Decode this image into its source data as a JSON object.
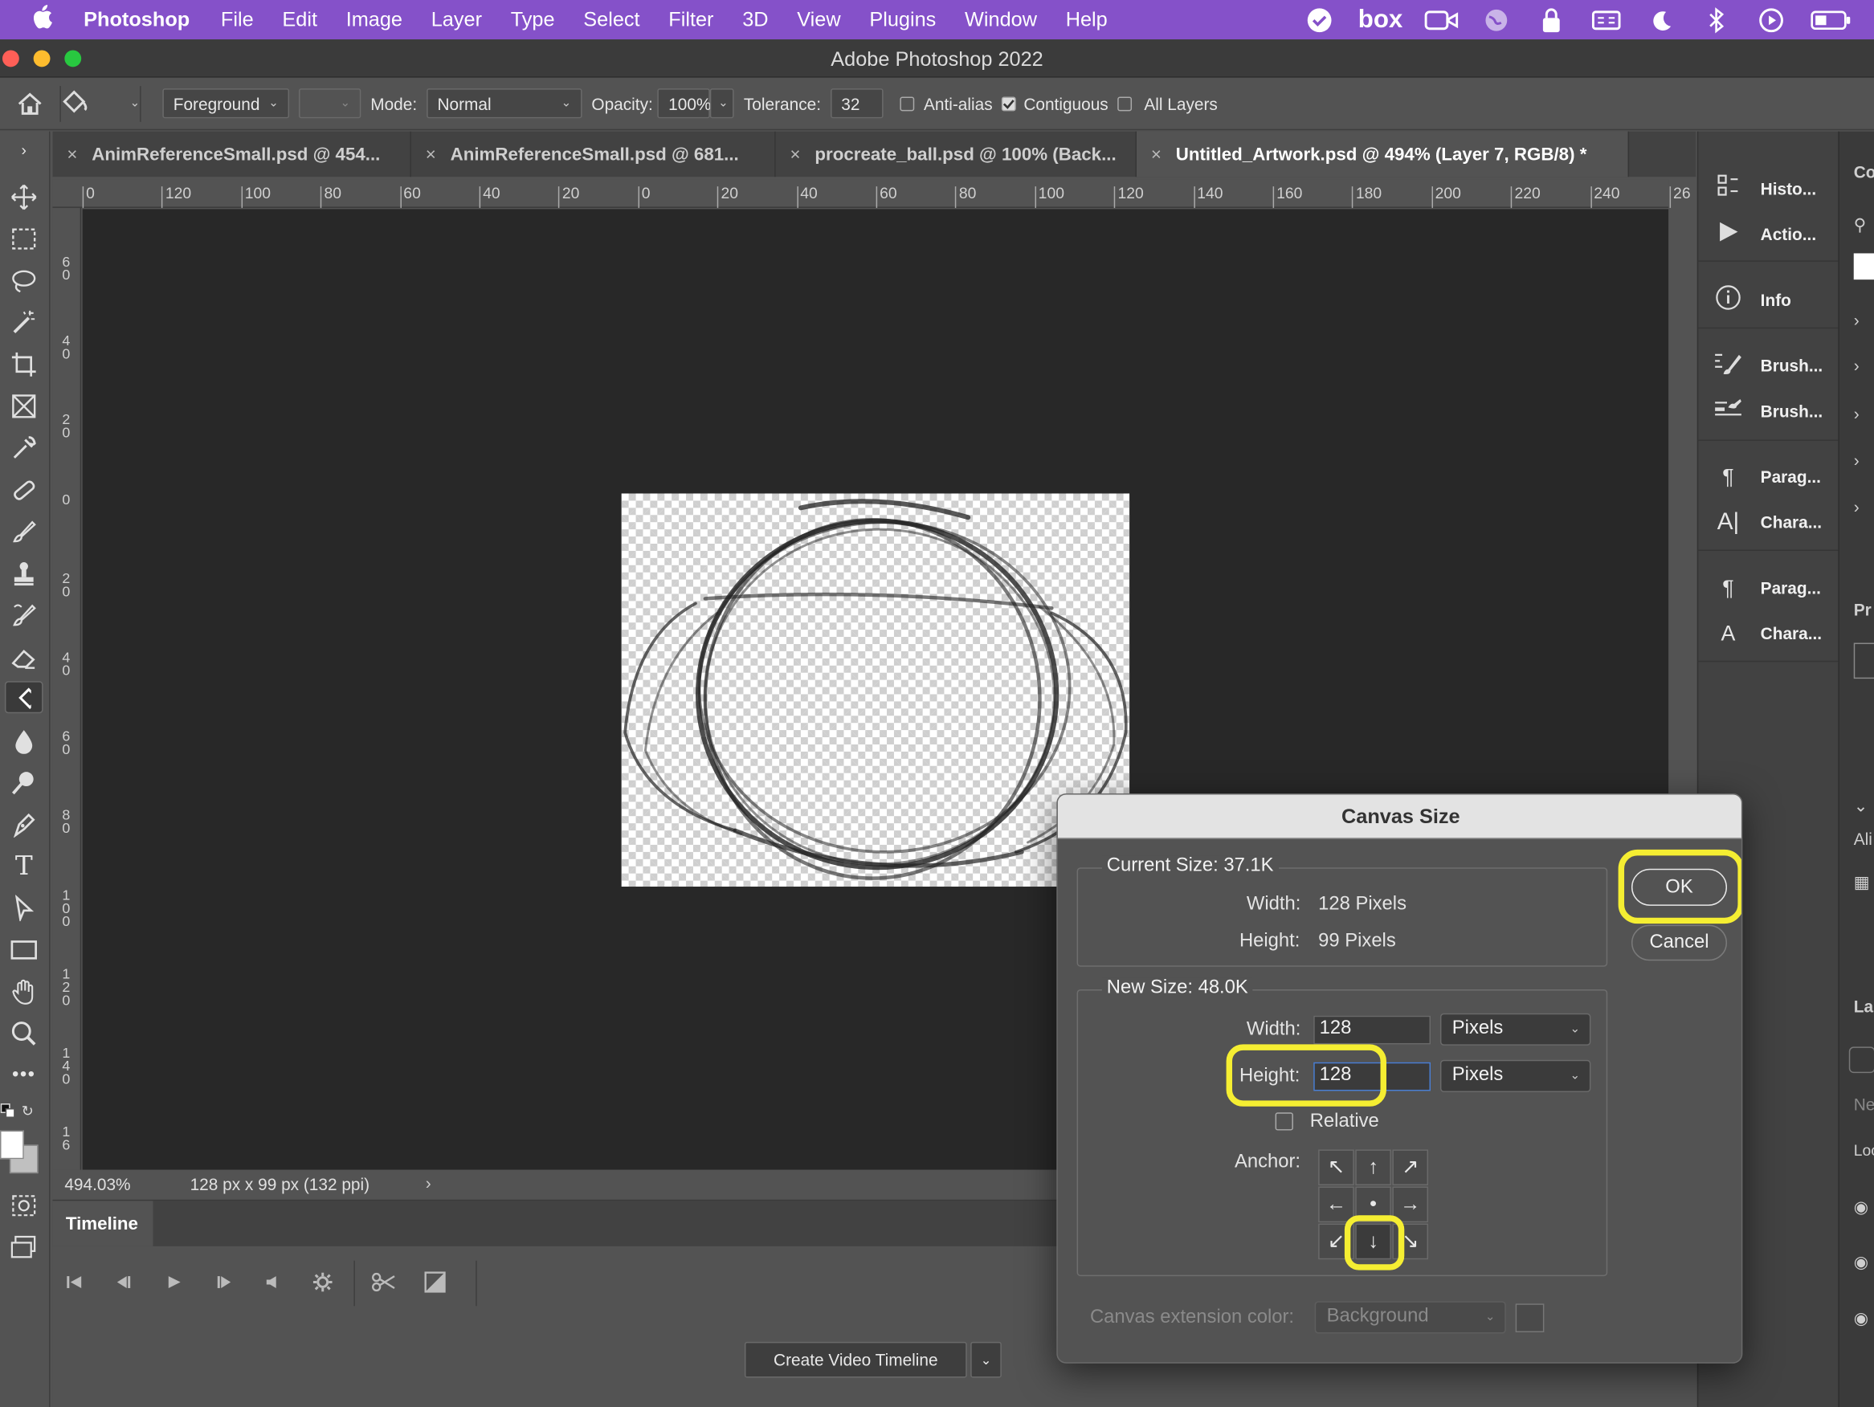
{
  "menubar": {
    "app": "Photoshop",
    "items": [
      "File",
      "Edit",
      "Image",
      "Layer",
      "Type",
      "Select",
      "Filter",
      "3D",
      "View",
      "Plugins",
      "Window",
      "Help"
    ],
    "status_icons": [
      "check-circle-icon",
      "box-logo",
      "facetime-icon",
      "globe-icon",
      "lock-icon",
      "control-icon",
      "moon-icon",
      "bluetooth-icon",
      "play-circle-icon",
      "battery-icon"
    ],
    "box_label": "box"
  },
  "window": {
    "title": "Adobe Photoshop 2022"
  },
  "options": {
    "fill_source": "Foreground",
    "mode_label": "Mode:",
    "mode": "Normal",
    "opacity_label": "Opacity:",
    "opacity": "100%",
    "tolerance_label": "Tolerance:",
    "tolerance": "32",
    "antialias": {
      "label": "Anti-alias",
      "checked": false
    },
    "contiguous": {
      "label": "Contiguous",
      "checked": true
    },
    "alllayers": {
      "label": "All Layers",
      "checked": false
    }
  },
  "tabs": [
    {
      "label": "AnimReferenceSmall.psd @ 454...",
      "active": false
    },
    {
      "label": "AnimReferenceSmall.psd @ 681...",
      "active": false
    },
    {
      "label": "procreate_ball.psd @ 100% (Back...",
      "active": false
    },
    {
      "label": "Untitled_Artwork.psd @ 494% (Layer 7, RGB/8) *",
      "active": true
    }
  ],
  "hruler_ticks": [
    "0",
    "120",
    "100",
    "80",
    "60",
    "40",
    "20",
    "0",
    "20",
    "40",
    "60",
    "80",
    "100",
    "120",
    "140",
    "160",
    "180",
    "200",
    "220",
    "240",
    "26"
  ],
  "vruler_ticks": [
    "60",
    "40",
    "20",
    "0",
    "20",
    "40",
    "60",
    "80",
    "100",
    "120",
    "140",
    "16"
  ],
  "status": {
    "zoom": "494.03%",
    "doc_info": "128 px x 99 px (132 ppi)"
  },
  "timeline": {
    "tab": "Timeline",
    "create_button": "Create Video Timeline"
  },
  "panels": [
    {
      "label": "Histo...",
      "icon": "histogram-icon"
    },
    {
      "label": "Actio...",
      "icon": "play-icon"
    },
    {
      "label": "Info",
      "icon": "info-icon"
    },
    {
      "label": "Brush...",
      "icon": "brush-settings-icon"
    },
    {
      "label": "Brush...",
      "icon": "brushes-icon"
    },
    {
      "label": "Parag...",
      "icon": "paragraph-icon"
    },
    {
      "label": "Chara...",
      "icon": "character-icon"
    },
    {
      "label": "Parag...",
      "icon": "paragraph-styles-icon"
    },
    {
      "label": "Chara...",
      "icon": "character-styles-icon"
    }
  ],
  "farright": [
    "Co",
    "Pr",
    "Ali",
    "La",
    "Ne",
    "Loc"
  ],
  "dialog": {
    "title": "Canvas Size",
    "current_size": "Current Size: 37.1K",
    "width_label": "Width:",
    "height_label": "Height:",
    "current_width": "128 Pixels",
    "current_height": "99 Pixels",
    "new_size": "New Size: 48.0K",
    "new_width": "128",
    "new_height": "128",
    "unit": "Pixels",
    "relative": {
      "label": "Relative",
      "checked": false
    },
    "anchor_label": "Anchor:",
    "anchor_selected": "bottom-center",
    "extension_label": "Canvas extension color:",
    "extension_value": "Background",
    "ok": "OK",
    "cancel": "Cancel",
    "highlight_color": "#f5ee32"
  }
}
